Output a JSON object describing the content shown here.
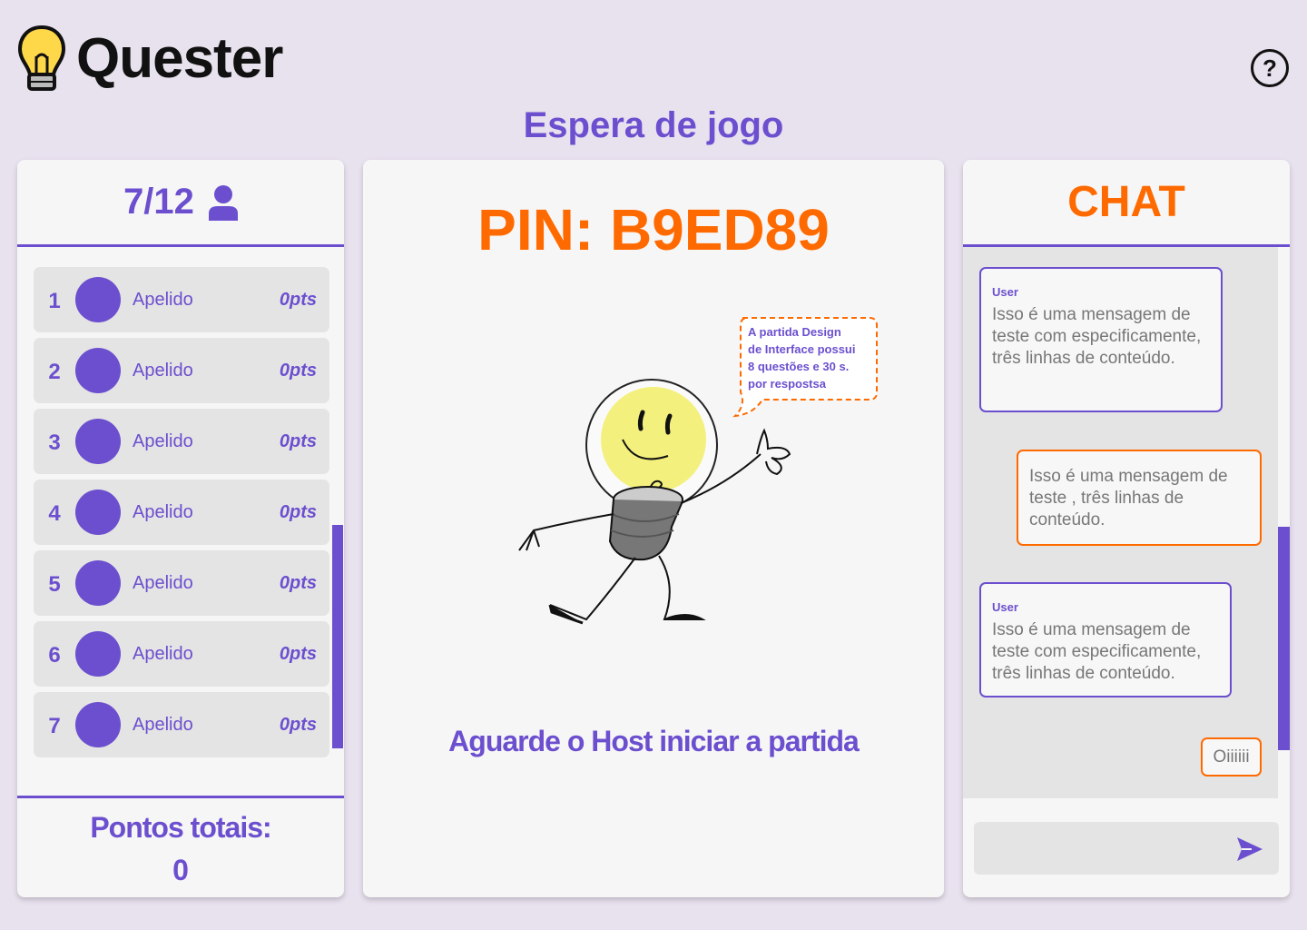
{
  "header": {
    "app_name": "Quester",
    "help_icon": "help-circle-icon",
    "help_label": "?"
  },
  "page_title": "Espera de jogo",
  "players": {
    "count": "7/12",
    "count_icon": "user-icon",
    "list": [
      {
        "rank": "1",
        "name": "Apelido",
        "points": "0pts"
      },
      {
        "rank": "2",
        "name": "Apelido",
        "points": "0pts"
      },
      {
        "rank": "3",
        "name": "Apelido",
        "points": "0pts"
      },
      {
        "rank": "4",
        "name": "Apelido",
        "points": "0pts"
      },
      {
        "rank": "5",
        "name": "Apelido",
        "points": "0pts"
      },
      {
        "rank": "6",
        "name": "Apelido",
        "points": "0pts"
      },
      {
        "rank": "7",
        "name": "Apelido",
        "points": "0pts"
      }
    ],
    "total_label": "Pontos totais:",
    "total_value": "0"
  },
  "game": {
    "pin": "PIN: B9ED89",
    "speech": [
      "A partida Design",
      "de Interface possui",
      "8 questões e 30 s.",
      "por respostsa"
    ],
    "wait_message": "Aguarde o Host iniciar a partida"
  },
  "chat": {
    "title": "CHAT",
    "messages": [
      {
        "author": "User",
        "text": "Isso é uma mensagem de teste com especificamente, três linhas de conteúdo."
      },
      {
        "author": "",
        "text": "Isso é uma mensagem de teste , três linhas de conteúdo."
      },
      {
        "author": "User",
        "text": "Isso é uma mensagem de teste com especificamente, três linhas de conteúdo."
      },
      {
        "author": "",
        "text": "Oiiiiii"
      }
    ],
    "input_placeholder": "",
    "send_icon": "send-icon"
  },
  "colors": {
    "purple": "#6c4fcf",
    "orange": "#ff6a00",
    "background": "#e8e1ee"
  }
}
